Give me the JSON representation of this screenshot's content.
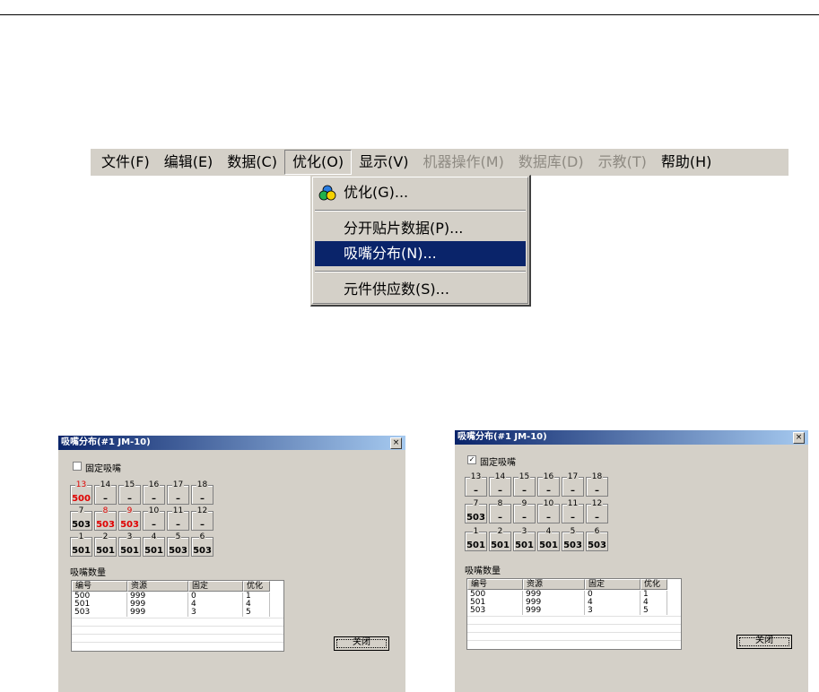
{
  "menu": {
    "items": [
      {
        "label": "文件(F)"
      },
      {
        "label": "编辑(E)"
      },
      {
        "label": "数据(C)"
      },
      {
        "label": "优化(O)"
      },
      {
        "label": "显示(V)"
      },
      {
        "label": "机器操作(M)"
      },
      {
        "label": "数据库(D)"
      },
      {
        "label": "示教(T)"
      },
      {
        "label": "帮助(H)"
      }
    ],
    "dropdown": {
      "optimize": "优化(G)...",
      "split": "分开贴片数据(P)...",
      "nozzle": "吸嘴分布(N)...",
      "feeder": "元件供应数(S)..."
    }
  },
  "dialog_left": {
    "title": "吸嘴分布(#1 JM-10)",
    "close": "×",
    "fixed_label": "固定吸嘴",
    "checked": "",
    "row1": [
      {
        "n": "13",
        "v": "500"
      },
      {
        "n": "14",
        "v": "–"
      },
      {
        "n": "15",
        "v": "–"
      },
      {
        "n": "16",
        "v": "–"
      },
      {
        "n": "17",
        "v": "–"
      },
      {
        "n": "18",
        "v": "–"
      }
    ],
    "row2": [
      {
        "n": "7",
        "v": "503"
      },
      {
        "n": "8",
        "v": "503"
      },
      {
        "n": "9",
        "v": "503"
      },
      {
        "n": "10",
        "v": "–"
      },
      {
        "n": "11",
        "v": "–"
      },
      {
        "n": "12",
        "v": "–"
      }
    ],
    "row3": [
      {
        "n": "1",
        "v": "501"
      },
      {
        "n": "2",
        "v": "501"
      },
      {
        "n": "3",
        "v": "501"
      },
      {
        "n": "4",
        "v": "501"
      },
      {
        "n": "5",
        "v": "503"
      },
      {
        "n": "6",
        "v": "503"
      }
    ],
    "count_label": "吸嘴数量",
    "table": {
      "headers": [
        "编号",
        "资源",
        "固定",
        "优化"
      ],
      "rows": [
        [
          "500",
          "999",
          "0",
          "1"
        ],
        [
          "501",
          "999",
          "4",
          "4"
        ],
        [
          "503",
          "999",
          "3",
          "5"
        ]
      ]
    },
    "close_button": "关闭"
  },
  "dialog_right": {
    "title": "吸嘴分布(#1 JM-10)",
    "close": "×",
    "fixed_label": "固定吸嘴",
    "checked": "✓",
    "row1": [
      {
        "n": "13",
        "v": "–"
      },
      {
        "n": "14",
        "v": "–"
      },
      {
        "n": "15",
        "v": "–"
      },
      {
        "n": "16",
        "v": "–"
      },
      {
        "n": "17",
        "v": "–"
      },
      {
        "n": "18",
        "v": "–"
      }
    ],
    "row2": [
      {
        "n": "7",
        "v": "503"
      },
      {
        "n": "8",
        "v": "–"
      },
      {
        "n": "9",
        "v": "–"
      },
      {
        "n": "10",
        "v": "–"
      },
      {
        "n": "11",
        "v": "–"
      },
      {
        "n": "12",
        "v": "–"
      }
    ],
    "row3": [
      {
        "n": "1",
        "v": "501"
      },
      {
        "n": "2",
        "v": "501"
      },
      {
        "n": "3",
        "v": "501"
      },
      {
        "n": "4",
        "v": "501"
      },
      {
        "n": "5",
        "v": "503"
      },
      {
        "n": "6",
        "v": "503"
      }
    ],
    "count_label": "吸嘴数量",
    "table": {
      "headers": [
        "编号",
        "资源",
        "固定",
        "优化"
      ],
      "rows": [
        [
          "500",
          "999",
          "0",
          "1"
        ],
        [
          "501",
          "999",
          "4",
          "4"
        ],
        [
          "503",
          "999",
          "3",
          "5"
        ]
      ]
    },
    "close_button": "关闭"
  }
}
